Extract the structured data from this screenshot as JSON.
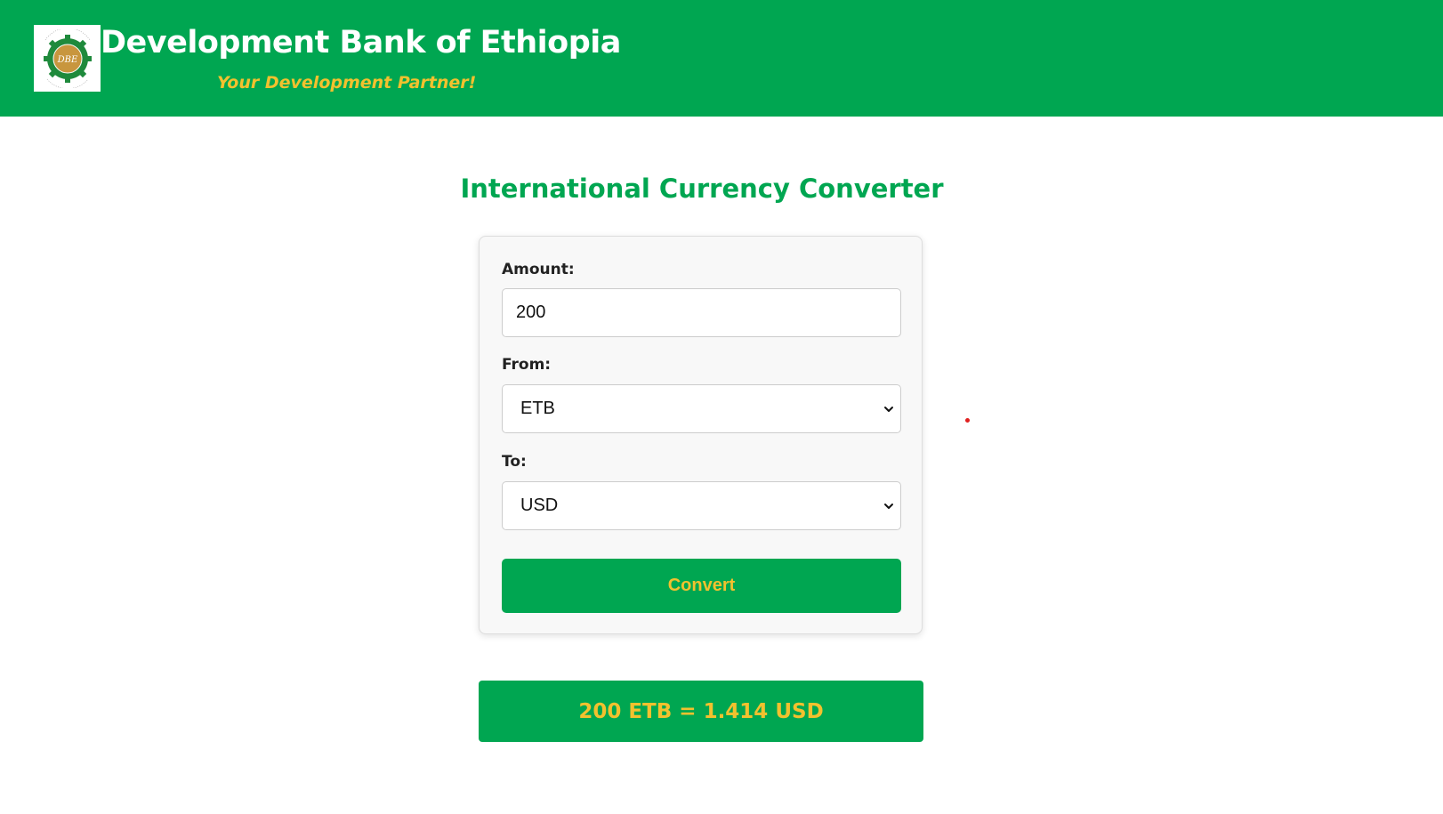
{
  "header": {
    "title": "Development Bank of Ethiopia",
    "tagline": "Your Development Partner!",
    "logo_monogram": "DBE",
    "logo_icon": "gear-emblem-logo-icon",
    "brand_color": "#00a651",
    "accent_color": "#f2c12e"
  },
  "converter": {
    "heading": "International Currency Converter",
    "amount_label": "Amount:",
    "amount_value": "200",
    "from_label": "From:",
    "from_value": "ETB",
    "to_label": "To:",
    "to_value": "USD",
    "convert_label": "Convert",
    "dropdown_icon": "chevron-down-icon"
  },
  "result": {
    "text": "200 ETB = 1.414 USD"
  }
}
